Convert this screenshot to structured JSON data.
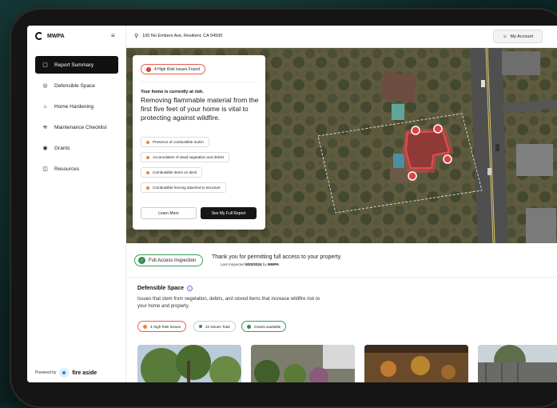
{
  "brand": {
    "name": "MWPA",
    "powered_by": "Powered by",
    "partner": "fire aside"
  },
  "header": {
    "address": "100 No Embers Ave, Resilient, CA 94930",
    "account_label": "My Account"
  },
  "sidebar": {
    "items": [
      {
        "label": "Report Summary",
        "active": true,
        "icon": "document-icon"
      },
      {
        "label": "Defensible Space",
        "active": false,
        "icon": "target-icon"
      },
      {
        "label": "Home Hardening",
        "active": false,
        "icon": "house-icon"
      },
      {
        "label": "Maintenance Checklist",
        "active": false,
        "icon": "sliders-icon"
      },
      {
        "label": "Grants",
        "active": false,
        "icon": "coin-icon"
      },
      {
        "label": "Resources",
        "active": false,
        "icon": "book-icon"
      }
    ]
  },
  "risk_card": {
    "badge": "4 High Risk Issues Found",
    "badge_count": "!",
    "status": "Your home is currently at risk.",
    "headline": "Removing flammable material from the first five feet of your home is vital to protecting against wildfire.",
    "issues": [
      "Presence of combustible mulch",
      "Accumulation of dead vegetation and debris",
      "Combustible items on deck",
      "Combustible fencing attached to structure"
    ],
    "learn_more": "Learn More",
    "full_report": "See My Full Report"
  },
  "access": {
    "badge": "Full Access Inspection",
    "title": "Thank you for permitting full access to your property.",
    "inspected_prefix": "Last Inspected",
    "inspected_date": "8/20/2024",
    "inspected_by_prefix": "by",
    "inspected_by": "MWPA"
  },
  "defensible": {
    "title": "Defensible Space",
    "description": "Issues that stem from vegetation, debris, and stored items that increase wildfire risk to your home and property.",
    "chips": [
      {
        "label": "4 High Risk Issues",
        "color": "#e8833a",
        "border": "#e85d4f"
      },
      {
        "label": "22 Issues Total",
        "color": "#2f8f4e",
        "border": "#cccccc"
      },
      {
        "label": "Grants available",
        "color": "#2f8f4e",
        "border": "#3d9b5c"
      }
    ]
  },
  "colors": {
    "accent_dark": "#161616",
    "risk_red": "#d9362b",
    "ok_green": "#2f8f4e"
  }
}
